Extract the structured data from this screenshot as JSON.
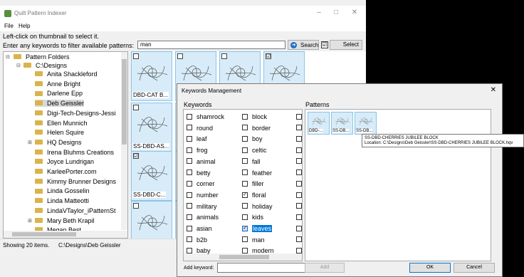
{
  "window": {
    "title": "Quilt Pattern Indexer",
    "minimize_icon": "minimize-icon",
    "maximize_icon": "maximize-icon",
    "close_icon": "close-icon"
  },
  "menu": {
    "file": "File",
    "help": "Help"
  },
  "instructions": {
    "line1": "Left-click on thumbnail to select it.",
    "line2": "Enter any keywords to filter available patterns:"
  },
  "filter": {
    "value": "man"
  },
  "toolbar": {
    "search_label": "Search",
    "select_label": "Select",
    "select_checked": "☑"
  },
  "tree": {
    "root": "Pattern Folders",
    "drive": "C:\\Designs",
    "items": [
      "Anita Shackleford",
      "Anne Bright",
      "Darlene Epp",
      "Deb Geissler",
      "Digi-Tech-Designs-Jessi",
      "Ellen Munnich",
      "Helen Squire",
      "HQ Designs",
      "Irena Bluhms Creations",
      "Joyce Lundrigan",
      "KarleePorter.com",
      "Kimmy Brunner Designs",
      "Linda Gosselin",
      "Linda Matteotti",
      "LindaVTaylor_iPatternSt",
      "Mary Beth Krapil",
      "Megan Best"
    ],
    "selected": "Deb Geissler"
  },
  "status": {
    "count": "Showing 20 items.",
    "path": "C:\\Designs\\Deb Geissler"
  },
  "thumbnails": [
    {
      "caption": "DBD-CAT B...",
      "checked": ""
    },
    {
      "caption": "",
      "checked": ""
    },
    {
      "caption": "",
      "checked": ""
    },
    {
      "caption": "",
      "checked": "☑"
    },
    {
      "caption": "SS-DBD-AS...",
      "checked": ""
    },
    {
      "caption": "S",
      "checked": ""
    },
    {
      "caption": "SS-DBD-C...",
      "checked": "☑"
    },
    {
      "caption": "S",
      "checked": ""
    },
    {
      "caption": "",
      "checked": ""
    },
    {
      "caption": "",
      "checked": ""
    }
  ],
  "dialog": {
    "title": "Keywords Management",
    "keywords_label": "Keywords",
    "patterns_label": "Patterns",
    "keywords_col1": [
      "shamrock",
      "round",
      "leaf",
      "frog",
      "animal",
      "betty",
      "corner",
      "number",
      "military",
      "animals",
      "asian",
      "b2b",
      "baby"
    ],
    "keywords_col2": [
      "block",
      "border",
      "boy",
      "celtic",
      "fall",
      "feather",
      "filler",
      "floral",
      "holiday",
      "kids",
      "leaves",
      "man",
      "modern"
    ],
    "checked": [
      "floral",
      "leaves"
    ],
    "selected": "leaves",
    "patterns": [
      {
        "caption": "DBD-..."
      },
      {
        "caption": "SS-DB..."
      },
      {
        "caption": "SS-DB..."
      }
    ],
    "tooltip": {
      "name": "SS-DBD-CHERRIES JUBILEE BLOCK",
      "location": "Location: C:\\Designs\\Deb Geissler\\SS-DBD-CHERRIES JUBILEE BLOCK.hqv"
    },
    "add_keyword_label": "Add keyword:",
    "add_keyword_value": "",
    "add_label": "Add",
    "ok_label": "OK",
    "cancel_label": "Cancel"
  }
}
